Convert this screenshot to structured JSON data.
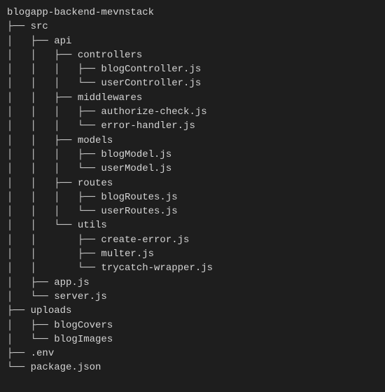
{
  "tree": {
    "root": "blogapp-backend-mevnstack",
    "lines": [
      {
        "prefix": "",
        "name": "blogapp-backend-mevnstack"
      },
      {
        "prefix": "├── ",
        "name": "src"
      },
      {
        "prefix": "│   ├── ",
        "name": "api"
      },
      {
        "prefix": "│   │   ├── ",
        "name": "controllers"
      },
      {
        "prefix": "│   │   │   ├── ",
        "name": "blogController.js"
      },
      {
        "prefix": "│   │   │   └── ",
        "name": "userController.js"
      },
      {
        "prefix": "│   │   ├── ",
        "name": "middlewares"
      },
      {
        "prefix": "│   │   │   ├── ",
        "name": "authorize-check.js"
      },
      {
        "prefix": "│   │   │   └── ",
        "name": "error-handler.js"
      },
      {
        "prefix": "│   │   ├── ",
        "name": "models"
      },
      {
        "prefix": "│   │   │   ├── ",
        "name": "blogModel.js"
      },
      {
        "prefix": "│   │   │   └── ",
        "name": "userModel.js"
      },
      {
        "prefix": "│   │   ├── ",
        "name": "routes"
      },
      {
        "prefix": "│   │   │   ├── ",
        "name": "blogRoutes.js"
      },
      {
        "prefix": "│   │   │   └── ",
        "name": "userRoutes.js"
      },
      {
        "prefix": "│   │   └── ",
        "name": "utils"
      },
      {
        "prefix": "│   │       ├── ",
        "name": "create-error.js"
      },
      {
        "prefix": "│   │       ├── ",
        "name": "multer.js"
      },
      {
        "prefix": "│   │       └── ",
        "name": "trycatch-wrapper.js"
      },
      {
        "prefix": "│   ├── ",
        "name": "app.js"
      },
      {
        "prefix": "│   └── ",
        "name": "server.js"
      },
      {
        "prefix": "├── ",
        "name": "uploads"
      },
      {
        "prefix": "│   ├── ",
        "name": "blogCovers"
      },
      {
        "prefix": "│   └── ",
        "name": "blogImages"
      },
      {
        "prefix": "├── ",
        "name": ".env"
      },
      {
        "prefix": "└── ",
        "name": "package.json"
      }
    ]
  }
}
